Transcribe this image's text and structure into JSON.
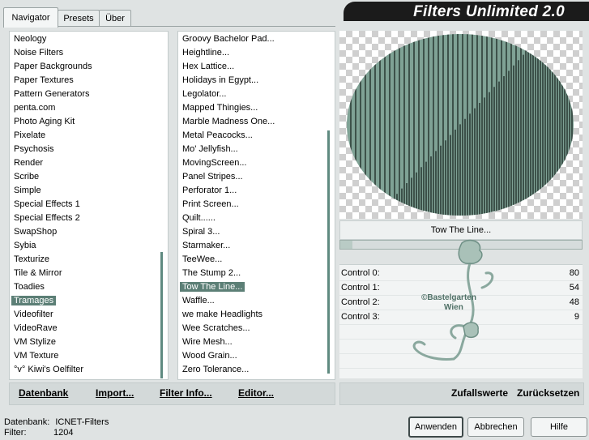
{
  "tabs": [
    {
      "label": "Navigator"
    },
    {
      "label": "Presets"
    },
    {
      "label": "Über"
    }
  ],
  "header": {
    "title": "Filters Unlimited 2.0"
  },
  "categories": {
    "items": [
      "Neology",
      "Noise Filters",
      "Paper Backgrounds",
      "Paper Textures",
      "Pattern Generators",
      "penta.com",
      "Photo Aging Kit",
      "Pixelate",
      "Psychosis",
      "Render",
      "Scribe",
      "Simple",
      "Special Effects 1",
      "Special Effects 2",
      "SwapShop",
      "Sybia",
      "Texturize",
      "Tile & Mirror",
      "Toadies",
      "Tramages",
      "Videofilter",
      "VideoRave",
      "VM Stylize",
      "VM Texture",
      "°v° Kiwi's Oelfilter"
    ],
    "selected_index": 19
  },
  "filters": {
    "items": [
      "Groovy Bachelor Pad...",
      "Heightline...",
      "Hex Lattice...",
      "Holidays in Egypt...",
      "Legolator...",
      "Mapped Thingies...",
      "Marble Madness One...",
      "Metal Peacocks...",
      "Mo' Jellyfish...",
      "MovingScreen...",
      "Panel Stripes...",
      "Perforator 1...",
      "Print Screen...",
      "Quilt......",
      "Spiral 3...",
      "Starmaker...",
      "TeeWee...",
      "The Stump 2...",
      "Tow The Line...",
      "Waffle...",
      "we make Headlights",
      "Wee Scratches...",
      "Wire Mesh...",
      "Wood Grain...",
      "Zero Tolerance..."
    ],
    "selected_index": 18
  },
  "preview": {
    "filter_name": "Tow The Line...",
    "colors": {
      "green": "#7fa295",
      "dark": "#1f2e29"
    }
  },
  "progress": {
    "value": 0.05
  },
  "controls": [
    {
      "label": "Control 0:",
      "value": "80"
    },
    {
      "label": "Control 1:",
      "value": "54"
    },
    {
      "label": "Control 2:",
      "value": "48"
    },
    {
      "label": "Control 3:",
      "value": "9"
    }
  ],
  "watermark": {
    "line1": "©Bastelgarten",
    "line2": "Wien"
  },
  "buttons": {
    "datenbank": "Datenbank",
    "import": "Import...",
    "filter_info": "Filter Info...",
    "editor": "Editor...",
    "zufallswerte": "Zufallswerte",
    "zuruecksetzen": "Zurücksetzen",
    "anwenden": "Anwenden",
    "abbrechen": "Abbrechen",
    "hilfe": "Hilfe"
  },
  "status": {
    "db_label": "Datenbank:",
    "db_value": "ICNET-Filters",
    "filter_label": "Filter:",
    "filter_value": "1204"
  },
  "accent_color": "#5c7f76"
}
